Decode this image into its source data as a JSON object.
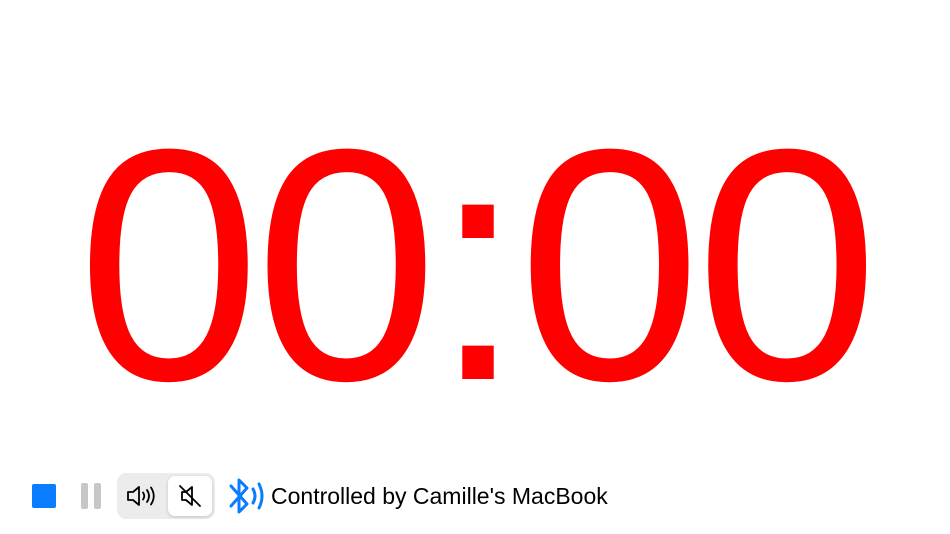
{
  "timer": {
    "display": "00:00",
    "color": "#ff0000"
  },
  "controls": {
    "stop_icon": "stop-square-icon",
    "pause_icon": "pause-icon",
    "sound_on_icon": "speaker-wave-icon",
    "sound_off_icon": "speaker-muted-icon",
    "sound_selected": "muted",
    "connection_icon": "bluetooth-icon",
    "status_text": "Controlled by Camille's MacBook",
    "accent_color": "#0a7cff",
    "disabled_color": "#c7c7c7"
  }
}
